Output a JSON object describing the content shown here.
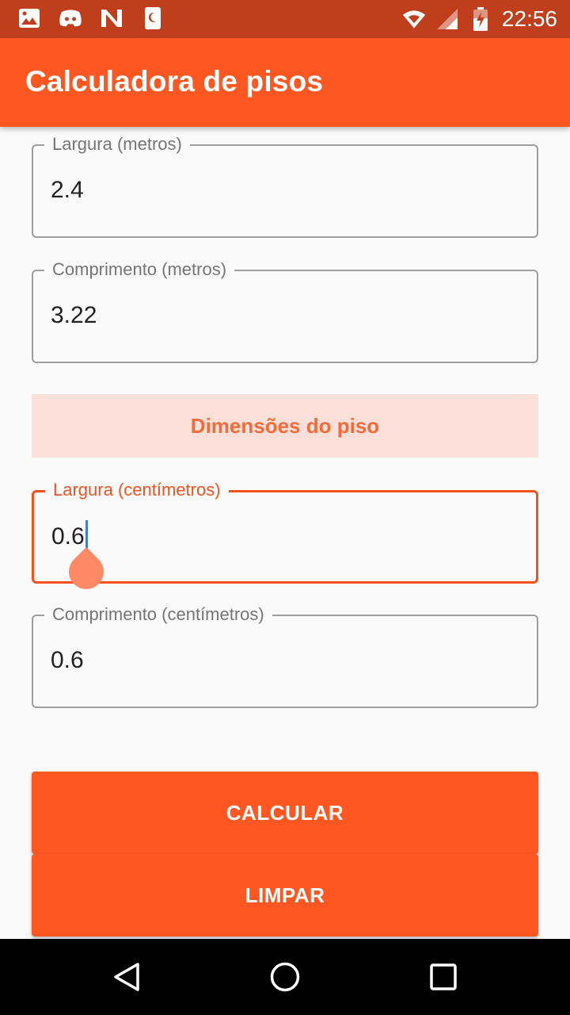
{
  "status_bar": {
    "time": "22:56",
    "left_icons": [
      "image-icon",
      "discord-icon",
      "n-app-icon",
      "sleep-icon"
    ],
    "right_icons": [
      "wifi-icon",
      "signal-icon",
      "battery-charging-icon"
    ]
  },
  "app_bar": {
    "title": "Calculadora de pisos"
  },
  "room": {
    "width_label": "Largura (metros)",
    "width_value": "2.4",
    "length_label": "Comprimento (metros)",
    "length_value": "3.22"
  },
  "tile_section": {
    "title": "Dimensões do piso"
  },
  "tile": {
    "width_label": "Largura (centímetros)",
    "width_value": "0.6",
    "length_label": "Comprimento (centímetros)",
    "length_value": "0.6"
  },
  "actions": {
    "calculate_label": "CALCULAR",
    "clear_label": "LIMPAR"
  },
  "nav_bar": {
    "icons": [
      "back-icon",
      "home-icon",
      "recents-icon"
    ]
  },
  "colors": {
    "primary": "#ff5722",
    "status_bar": "#bf3f1c",
    "section_bg": "#fbe0d9",
    "focus": "#f4511e"
  }
}
